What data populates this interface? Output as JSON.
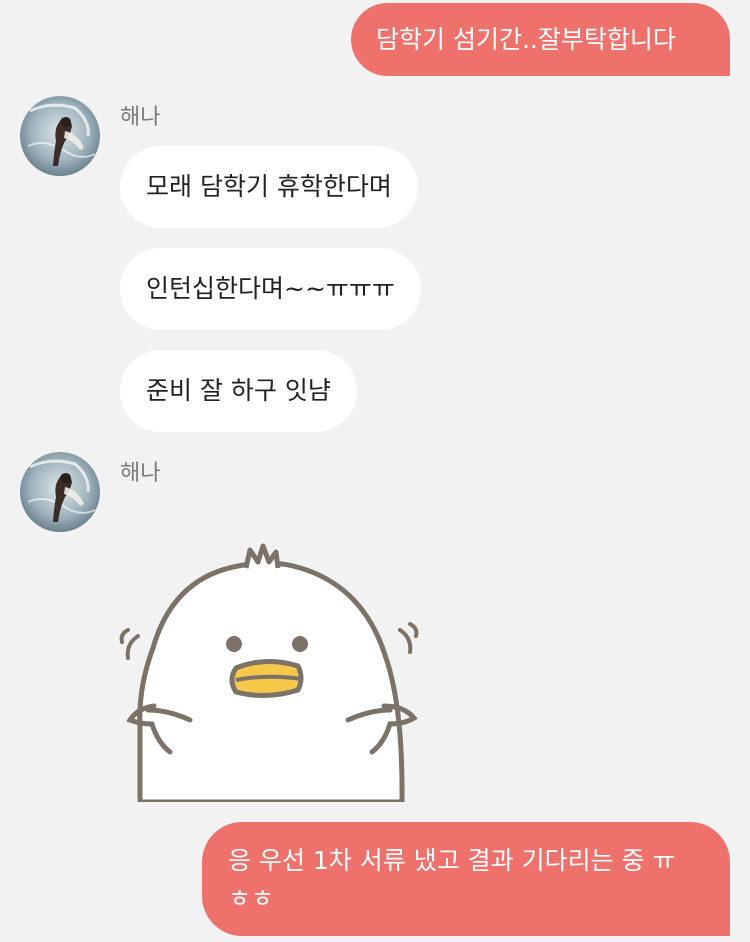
{
  "messages": [
    {
      "side": "out",
      "text": "담학기 섬기간..잘부탁합니다"
    },
    {
      "side": "in",
      "sender": "해나",
      "bubbles": [
        "모래 담학기 휴학한다며",
        "인턴십한다며~~ㅠㅠㅠ",
        "준비 잘 하구 잇냠"
      ]
    },
    {
      "side": "in",
      "sender": "해나",
      "sticker": "white-duck-sticker"
    },
    {
      "side": "out",
      "lines": [
        "응 우선 1차 서류 냈고 결과 기다리는 중 ㅠ",
        "ㅎㅎ"
      ]
    }
  ],
  "colors": {
    "outgoing_bubble": "#ee716c",
    "incoming_bubble": "#ffffff",
    "background": "#f2f2f2",
    "sender_name": "#7a7a7a"
  }
}
